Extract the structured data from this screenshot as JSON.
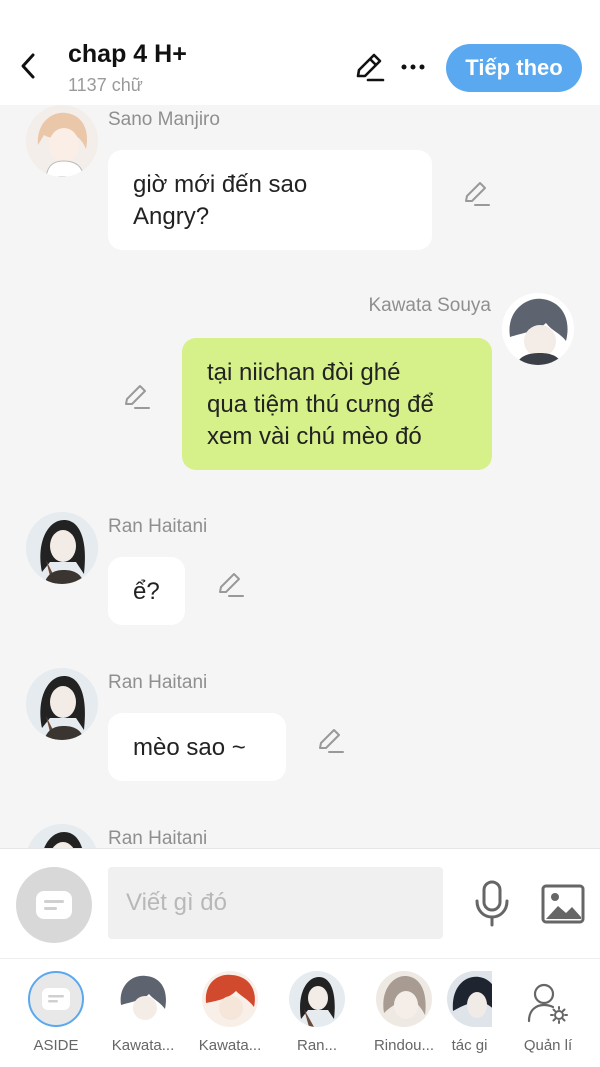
{
  "header": {
    "title": "chap 4 H+",
    "subtitle": "1137 chữ",
    "next_label": "Tiếp theo"
  },
  "messages": [
    {
      "sender": "Sano Manjiro",
      "text_lines": [
        "giờ mới đến sao",
        "Angry?"
      ],
      "mine": false
    },
    {
      "sender": "Kawata Souya",
      "text_lines": [
        "tại niichan đòi ghé",
        "qua tiệm thú cưng để",
        "xem vài chú mèo đó"
      ],
      "mine": true
    },
    {
      "sender": "Ran Haitani",
      "text_lines": [
        "ể?"
      ],
      "mine": false
    },
    {
      "sender": "Ran Haitani",
      "text_lines": [
        "mèo sao ~"
      ],
      "mine": false
    },
    {
      "sender": "Ran Haitani",
      "text_lines": [],
      "mine": false
    }
  ],
  "input": {
    "placeholder": "Viết gì đó"
  },
  "characters": [
    {
      "label": "ASIDE"
    },
    {
      "label": "Kawata..."
    },
    {
      "label": "Kawata..."
    },
    {
      "label": "Ran..."
    },
    {
      "label": "Rindou..."
    },
    {
      "label": "tác gi"
    }
  ],
  "manage_label": "Quản lí",
  "colors": {
    "accent": "#5aa9f0",
    "my_bubble": "#d6f08a",
    "background": "#f5f5f5"
  }
}
